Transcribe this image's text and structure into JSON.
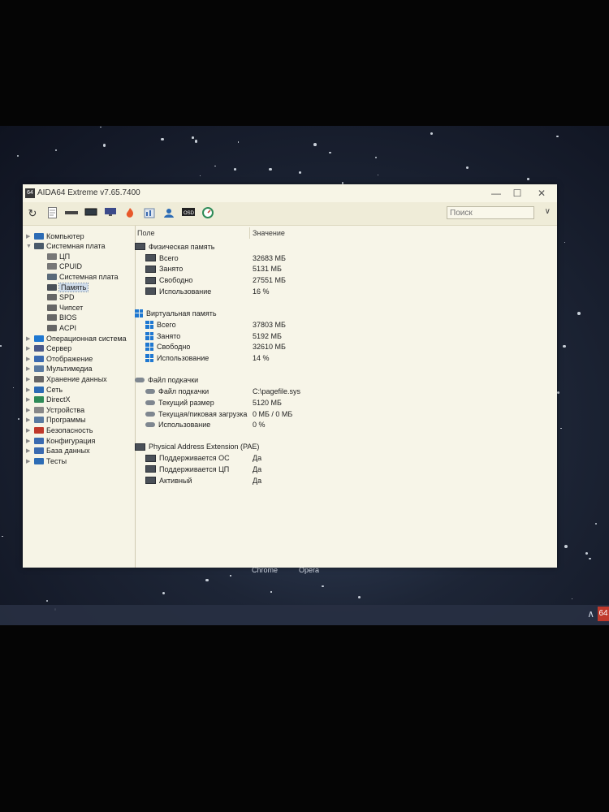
{
  "window": {
    "title": "AIDA64 Extreme v7.65.7400",
    "logo_text": "64",
    "controls": {
      "minimize": "—",
      "maximize": "☐",
      "close": "✕"
    }
  },
  "toolbar": {
    "icons": [
      "refresh-icon",
      "report-icon",
      "chip-icon",
      "board-icon",
      "flame-icon",
      "benchmark-icon",
      "user-icon",
      "osd-icon",
      "gauge-icon"
    ],
    "search_placeholder": "Поиск",
    "menu_chevron": "∨"
  },
  "tree": {
    "items": [
      {
        "label": "Компьютер",
        "level": 0,
        "expanded": false
      },
      {
        "label": "Системная плата",
        "level": 0,
        "expanded": true
      },
      {
        "label": "ЦП",
        "level": 1
      },
      {
        "label": "CPUID",
        "level": 1
      },
      {
        "label": "Системная плата",
        "level": 1
      },
      {
        "label": "Память",
        "level": 1,
        "selected": true
      },
      {
        "label": "SPD",
        "level": 1
      },
      {
        "label": "Чипсет",
        "level": 1
      },
      {
        "label": "BIOS",
        "level": 1
      },
      {
        "label": "ACPI",
        "level": 1
      },
      {
        "label": "Операционная система",
        "level": 0
      },
      {
        "label": "Сервер",
        "level": 0
      },
      {
        "label": "Отображение",
        "level": 0
      },
      {
        "label": "Мультимедиа",
        "level": 0
      },
      {
        "label": "Хранение данных",
        "level": 0
      },
      {
        "label": "Сеть",
        "level": 0
      },
      {
        "label": "DirectX",
        "level": 0
      },
      {
        "label": "Устройства",
        "level": 0
      },
      {
        "label": "Программы",
        "level": 0
      },
      {
        "label": "Безопасность",
        "level": 0
      },
      {
        "label": "Конфигурация",
        "level": 0
      },
      {
        "label": "База данных",
        "level": 0
      },
      {
        "label": "Тесты",
        "level": 0
      }
    ]
  },
  "detail": {
    "col_field": "Поле",
    "col_value": "Значение",
    "sections": [
      {
        "title": "Физическая память",
        "icon": "mem",
        "rows": [
          {
            "field": "Всего",
            "value": "32683 МБ"
          },
          {
            "field": "Занято",
            "value": "5131 МБ"
          },
          {
            "field": "Свободно",
            "value": "27551 МБ"
          },
          {
            "field": "Использование",
            "value": "16 %"
          }
        ]
      },
      {
        "title": "Виртуальная память",
        "icon": "win",
        "rows": [
          {
            "field": "Всего",
            "value": "37803 МБ"
          },
          {
            "field": "Занято",
            "value": "5192 МБ"
          },
          {
            "field": "Свободно",
            "value": "32610 МБ"
          },
          {
            "field": "Использование",
            "value": "14 %"
          }
        ]
      },
      {
        "title": "Файл подкачки",
        "icon": "disk",
        "rows": [
          {
            "field": "Файл подкачки",
            "value": "C:\\pagefile.sys"
          },
          {
            "field": "Текущий размер",
            "value": "5120 МБ"
          },
          {
            "field": "Текущая/пиковая загрузка",
            "value": "0 МБ / 0 МБ"
          },
          {
            "field": "Использование",
            "value": "0 %"
          }
        ]
      },
      {
        "title": "Physical Address Extension (PAE)",
        "icon": "mem",
        "rows": [
          {
            "field": "Поддерживается ОС",
            "value": "Да"
          },
          {
            "field": "Поддерживается ЦП",
            "value": "Да"
          },
          {
            "field": "Активный",
            "value": "Да"
          }
        ]
      }
    ]
  },
  "desktop": {
    "labels": [
      "Chrome",
      "Opera"
    ],
    "tray_app": "64",
    "tray_arrow": "∧"
  },
  "colors": {
    "accent": "#1f78d1",
    "selection": "#cfdcea",
    "window_bg": "#f1eedc"
  }
}
